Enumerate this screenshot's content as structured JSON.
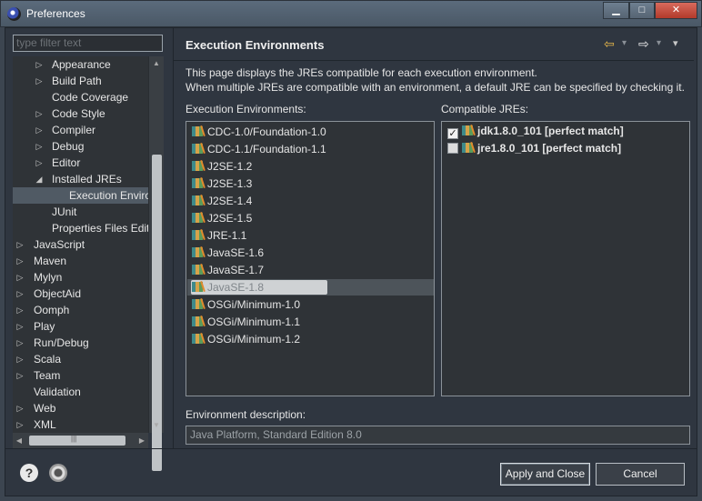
{
  "window": {
    "title": "Preferences",
    "min_glyph": "▁",
    "max_glyph": "□",
    "close_glyph": "✕"
  },
  "filter": {
    "placeholder": "type filter text"
  },
  "tree": {
    "items": [
      {
        "label": "Appearance",
        "level": 2,
        "arrow": "▷"
      },
      {
        "label": "Build Path",
        "level": 2,
        "arrow": "▷"
      },
      {
        "label": "Code Coverage",
        "level": 2,
        "arrow": ""
      },
      {
        "label": "Code Style",
        "level": 2,
        "arrow": "▷"
      },
      {
        "label": "Compiler",
        "level": 2,
        "arrow": "▷"
      },
      {
        "label": "Debug",
        "level": 2,
        "arrow": "▷"
      },
      {
        "label": "Editor",
        "level": 2,
        "arrow": "▷"
      },
      {
        "label": "Installed JREs",
        "level": 2,
        "arrow": "◢"
      },
      {
        "label": "Execution Enviro",
        "level": 3,
        "arrow": "",
        "selected": true
      },
      {
        "label": "JUnit",
        "level": 2,
        "arrow": ""
      },
      {
        "label": "Properties Files Edito",
        "level": 2,
        "arrow": ""
      },
      {
        "label": "JavaScript",
        "level": 1,
        "arrow": "▷"
      },
      {
        "label": "Maven",
        "level": 1,
        "arrow": "▷"
      },
      {
        "label": "Mylyn",
        "level": 1,
        "arrow": "▷"
      },
      {
        "label": "ObjectAid",
        "level": 1,
        "arrow": "▷"
      },
      {
        "label": "Oomph",
        "level": 1,
        "arrow": "▷"
      },
      {
        "label": "Play",
        "level": 1,
        "arrow": "▷"
      },
      {
        "label": "Run/Debug",
        "level": 1,
        "arrow": "▷"
      },
      {
        "label": "Scala",
        "level": 1,
        "arrow": "▷"
      },
      {
        "label": "Team",
        "level": 1,
        "arrow": "▷"
      },
      {
        "label": "Validation",
        "level": 1,
        "arrow": ""
      },
      {
        "label": "Web",
        "level": 1,
        "arrow": "▷"
      },
      {
        "label": "XML",
        "level": 1,
        "arrow": "▷"
      }
    ],
    "hscroll_grip": "|||"
  },
  "page": {
    "title": "Execution Environments",
    "description_line1": "This page displays the JREs compatible for each execution environment.",
    "description_line2": "When multiple JREs are compatible with an environment, a default JRE can be specified by checking it.",
    "back_glyph": "⇦",
    "forward_glyph": "⇨",
    "dropdown_glyph": "▾"
  },
  "environments": {
    "label": "Execution Environments:",
    "items": [
      {
        "label": "CDC-1.0/Foundation-1.0"
      },
      {
        "label": "CDC-1.1/Foundation-1.1"
      },
      {
        "label": "J2SE-1.2"
      },
      {
        "label": "J2SE-1.3"
      },
      {
        "label": "J2SE-1.4"
      },
      {
        "label": "J2SE-1.5"
      },
      {
        "label": "JRE-1.1"
      },
      {
        "label": "JavaSE-1.6"
      },
      {
        "label": "JavaSE-1.7"
      },
      {
        "label": "JavaSE-1.8",
        "selected": true
      },
      {
        "label": "OSGi/Minimum-1.0"
      },
      {
        "label": "OSGi/Minimum-1.1"
      },
      {
        "label": "OSGi/Minimum-1.2"
      }
    ]
  },
  "compatible": {
    "label": "Compatible JREs:",
    "items": [
      {
        "label": "jdk1.8.0_101 [perfect match]",
        "checked": true
      },
      {
        "label": "jre1.8.0_101 [perfect match]",
        "checked": false
      }
    ]
  },
  "env_description": {
    "label": "Environment description:",
    "value": "Java Platform, Standard Edition 8.0"
  },
  "buttons": {
    "apply_close": "Apply and Close",
    "cancel": "Cancel",
    "help_glyph": "?"
  }
}
